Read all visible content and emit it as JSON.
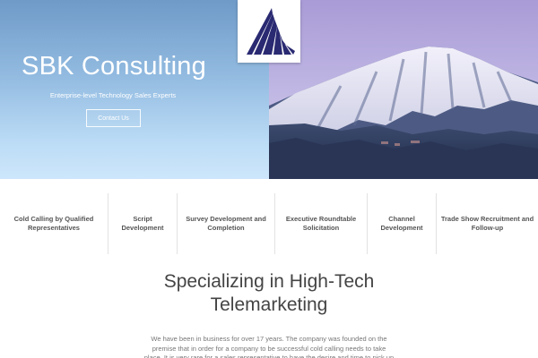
{
  "hero": {
    "title": "SBK Consulting",
    "tagline": "Enterprise-level Technology Sales Experts",
    "cta_label": "Contact Us",
    "gradient_top": "#6f9ac8",
    "gradient_bottom": "#cde6fb"
  },
  "logo": {
    "icon": "triangle-rays-logo",
    "color": "#2a2a72"
  },
  "services": [
    {
      "label": "Cold Calling by Qualified Representatives"
    },
    {
      "label": "Script Development"
    },
    {
      "label": "Survey Development and Completion"
    },
    {
      "label": "Executive Roundtable Solicitation"
    },
    {
      "label": "Channel Development"
    },
    {
      "label": "Trade Show Recruitment and Follow-up"
    }
  ],
  "main": {
    "headline": "Specializing in High-Tech Telemarketing",
    "intro": "We have been in business for over 17 years. The company was founded on the premise that in order for a company to be successful cold calling needs to take place. It is very rare for a sales representative to have the desire and time to pick up the phone to solicit new business."
  }
}
